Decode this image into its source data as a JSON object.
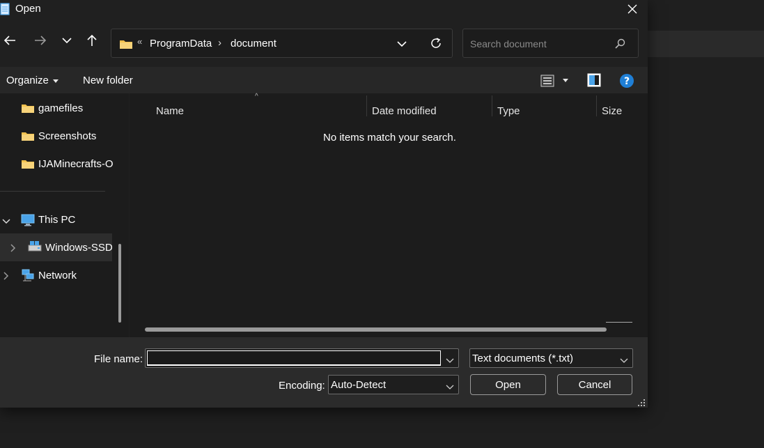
{
  "window": {
    "title": "Open"
  },
  "address": {
    "overflow": "«",
    "crumbs": [
      "ProgramData",
      "document"
    ],
    "separator": "›"
  },
  "search": {
    "placeholder": "Search document"
  },
  "toolbar": {
    "organize": "Organize",
    "new_folder": "New folder"
  },
  "sidebar": {
    "quick_items": [
      "gamefiles",
      "Screenshots",
      "IJAMinecrafts-O"
    ],
    "this_pc": "This PC",
    "drive": "Windows-SSD",
    "network": "Network"
  },
  "columns": [
    "Name",
    "Date modified",
    "Type",
    "Size"
  ],
  "empty_message": "No items match your search.",
  "footer": {
    "file_name_label": "File name:",
    "file_name_value": "",
    "file_type": "Text documents (*.txt)",
    "encoding_label": "Encoding:",
    "encoding_value": "Auto-Detect",
    "open_button": "Open",
    "cancel_button": "Cancel"
  },
  "colors": {
    "accent": "#4aa3e8",
    "folder": "#f2c14e",
    "background": "#1c1c1c",
    "panel": "#2b2b2b"
  }
}
